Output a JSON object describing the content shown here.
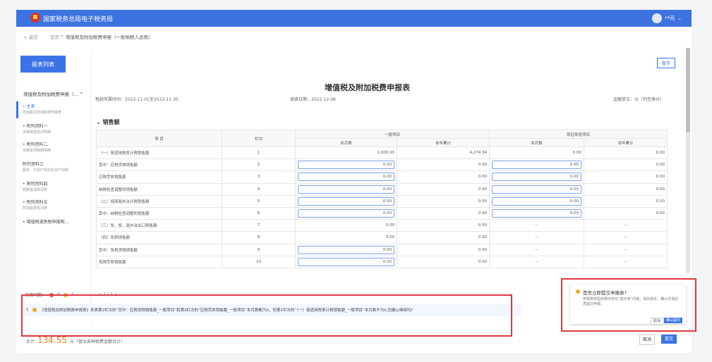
{
  "topbar": {
    "brand": "国家税务总局电子税务局",
    "user": "**司"
  },
  "breadcrumb": {
    "back": "< 返回",
    "home": "首页",
    "sep": ">",
    "current": "增值税及附加税费申报（一般纳税人适用）"
  },
  "sidebar": {
    "button": "报表列表",
    "group": "增值税及附加税费申报（... ^",
    "items": [
      {
        "label": "• 主表",
        "sub": "增值税及附加税费申报表"
      },
      {
        "label": "• 附列资料一",
        "sub": "本期销售情况明细"
      },
      {
        "label": "• 附列资料二",
        "sub": "本期进项税额明细"
      },
      {
        "label": "附列资料三",
        "sub": "服务、不动产和无形资产扣除"
      },
      {
        "label": "• 附列资料四",
        "sub": "税额抵减情况表"
      },
      {
        "label": "• 附列资料五",
        "sub": "附加税费情况表"
      },
      {
        "label": "• 增值税减免税申报明...",
        "sub": ""
      }
    ]
  },
  "report": {
    "title": "增值税及附加税费申报表",
    "period": "税款所属时间：2022-11-01至2022-11-30",
    "fill_date": "填表日期：2022-12-08",
    "unit": "金额单位：元（列至角分）",
    "save": "暂存",
    "section": "销售额"
  },
  "table": {
    "headers": {
      "item": "项 目",
      "col": "栏次",
      "general": "一般项目",
      "immediate": "即征即退项目",
      "month": "本月数",
      "year": "本年累计"
    },
    "rows": [
      {
        "item": "（一）按适用税率计税销售额",
        "col": "1",
        "a": "1,000.00",
        "b": "4,274.34",
        "c": "0.00",
        "d": "0.00",
        "ia": false,
        "ic": false
      },
      {
        "item": "其中：应税货物销售额",
        "col": "2",
        "a": "0.00",
        "b": "0.00",
        "c": "0.00",
        "d": "0.00",
        "ia": true,
        "ic": true
      },
      {
        "item": "应税劳务销售额",
        "col": "3",
        "a": "0.00",
        "b": "0.00",
        "c": "0.00",
        "d": "0.00",
        "ia": true,
        "ic": true
      },
      {
        "item": "纳税检查调整的销售额",
        "col": "4",
        "a": "0.00",
        "b": "0.00",
        "c": "0.00",
        "d": "0.00",
        "ia": true,
        "ic": true
      },
      {
        "item": "（二）按简易办法计税销售额",
        "col": "5",
        "a": "0.00",
        "b": "0.00",
        "c": "0.00",
        "d": "0.00",
        "ia": true,
        "ic": true
      },
      {
        "item": "其中：纳税检查调整的销售额",
        "col": "6",
        "a": "0.00",
        "b": "0.00",
        "c": "0.00",
        "d": "0.00",
        "ia": true,
        "ic": true
      },
      {
        "item": "（三）免、抵、退办法出口销售额",
        "col": "7",
        "a": "0.00",
        "b": "0.00",
        "c": "--",
        "d": "--",
        "ia": false,
        "ic": false
      },
      {
        "item": "（四）免税销售额",
        "col": "8",
        "a": "0.00",
        "b": "0.00",
        "c": "--",
        "d": "--",
        "ia": false,
        "ic": false
      },
      {
        "item": "其中：免税货物销售额",
        "col": "9",
        "a": "0.00",
        "b": "0.00",
        "c": "--",
        "d": "--",
        "ia": true,
        "ic": false
      },
      {
        "item": "免税劳务销售额",
        "col": "10",
        "a": "0.00",
        "b": "0.00",
        "c": "--",
        "d": "--",
        "ia": true,
        "ic": false
      }
    ]
  },
  "issues": {
    "label": "校验问题：",
    "red_count": "0",
    "orange_count": "1",
    "pager": "< 1 / 1 >",
    "row_index": "1",
    "message": "《增值税及附加税费申报表》本表第2栏次的“其中：应税货物销售额_一般项目”和第3栏次的“应税劳务销售额_一般项目”本月数都为0，但第1栏次的“（一）按适用税率计税销售额_一般项目”本月数不为0,您确认继续吗?"
  },
  "popup": {
    "title": "是否立即提交申报表?",
    "desc": "申报表校验结果中存在“提示类”问题，请先核实，确认无误后再提交申报。",
    "cancel": "取消",
    "confirm": "确认提交"
  },
  "footer": {
    "total_label": "合计",
    "total_amount": "134.55",
    "total_unit": "元（营业各种税费金额合计）",
    "cancel": "取消",
    "submit": "提交"
  }
}
